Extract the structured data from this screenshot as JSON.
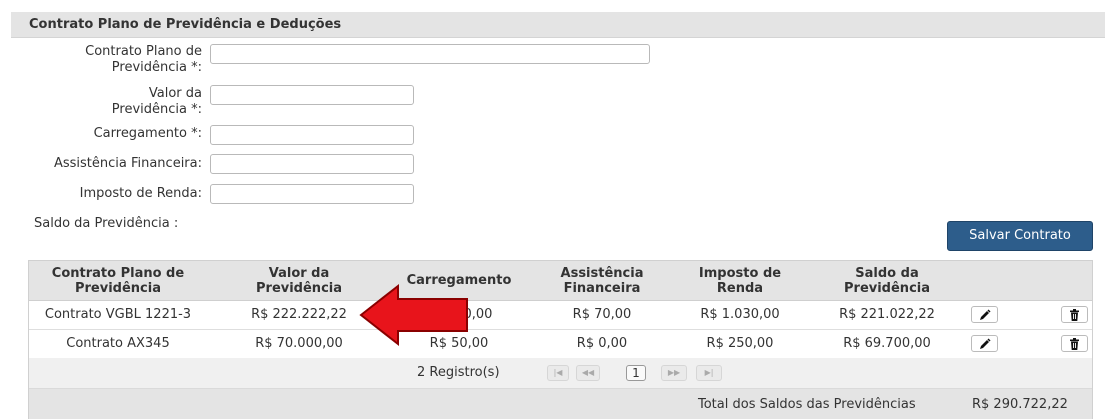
{
  "header": {
    "title": "Contrato Plano de Previdência e Deduções"
  },
  "form": {
    "contrato_label_1": "Contrato Plano de",
    "contrato_label_2": "Previdência *:",
    "valor_label_1": "Valor da",
    "valor_label_2": "Previdência *:",
    "carregamento_label": "Carregamento *:",
    "assistencia_label": "Assistência Financeira:",
    "imposto_label": "Imposto de Renda:",
    "saldo_label": "Saldo da Previdência :",
    "contrato_value": "",
    "valor_value": "",
    "carregamento_value": "",
    "assistencia_value": "",
    "imposto_value": "",
    "save_label": "Salvar Contrato"
  },
  "grid": {
    "columns": [
      {
        "line1": "Contrato Plano de",
        "line2": "Previdência"
      },
      {
        "line1": "Valor da",
        "line2": "Previdência"
      },
      {
        "line1": "Carregamento",
        "line2": ""
      },
      {
        "line1": "Assistência",
        "line2": "Financeira"
      },
      {
        "line1": "Imposto de",
        "line2": "Renda"
      },
      {
        "line1": "Saldo da",
        "line2": "Previdência"
      }
    ],
    "rows": [
      {
        "contrato": "Contrato VGBL 1221-3",
        "valor": "R$ 222.222,22",
        "carregamento": "R$ 100,00",
        "assistencia": "R$ 70,00",
        "imposto": "R$ 1.030,00",
        "saldo": "R$ 221.022,22"
      },
      {
        "contrato": "Contrato AX345",
        "valor": "R$ 70.000,00",
        "carregamento": "R$ 50,00",
        "assistencia": "R$ 0,00",
        "imposto": "R$ 250,00",
        "saldo": "R$ 69.700,00"
      }
    ],
    "pager": {
      "records": "2 Registro(s)",
      "current_page": "1",
      "first": "|◀",
      "prev": "◀◀",
      "next": "▶▶",
      "last": "▶|"
    },
    "footer": {
      "total_label": "Total dos Saldos das Previdências",
      "total_value": "R$ 290.722,22"
    }
  },
  "colors": {
    "save_button": "#2d5d8b",
    "arrow": "#e8141b",
    "header_bg": "#e4e4e4"
  },
  "icons": {
    "edit": "pencil-icon",
    "delete": "trash-icon",
    "annotation": "red-arrow-icon"
  }
}
